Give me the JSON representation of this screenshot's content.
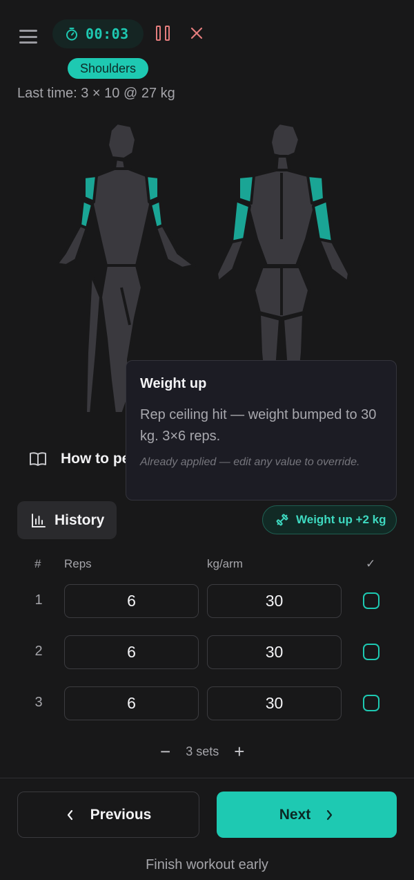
{
  "header": {
    "timer": "00:03",
    "muscle_tag": "Shoulders",
    "last_time": "Last time: 3 × 10 @ 27 kg"
  },
  "body_map": {
    "highlight_color": "#1aa595",
    "base_color": "#3a393e",
    "highlighted_muscles": [
      "shoulders",
      "triceps"
    ]
  },
  "how_to": {
    "label": "How to pe"
  },
  "tooltip": {
    "title": "Weight up",
    "body": "Rep ceiling hit — weight bumped to 30 kg. 3×6 reps.",
    "note": "Already applied — edit any value to override."
  },
  "history": {
    "label": "History"
  },
  "weight_badge": {
    "label": "Weight up +2 kg"
  },
  "sets_table": {
    "headers": {
      "num": "#",
      "reps": "Reps",
      "weight": "kg/arm",
      "done": "✓"
    },
    "rows": [
      {
        "num": "1",
        "reps": "6",
        "weight": "30",
        "done": false
      },
      {
        "num": "2",
        "reps": "6",
        "weight": "30",
        "done": false
      },
      {
        "num": "3",
        "reps": "6",
        "weight": "30",
        "done": false
      }
    ]
  },
  "sets_control": {
    "minus": "−",
    "label": "3 sets",
    "plus": "+"
  },
  "footer": {
    "previous": "Previous",
    "next": "Next",
    "finish": "Finish workout early"
  },
  "colors": {
    "accent": "#1ec9b2",
    "danger": "#e47d7d",
    "background": "#181819"
  }
}
